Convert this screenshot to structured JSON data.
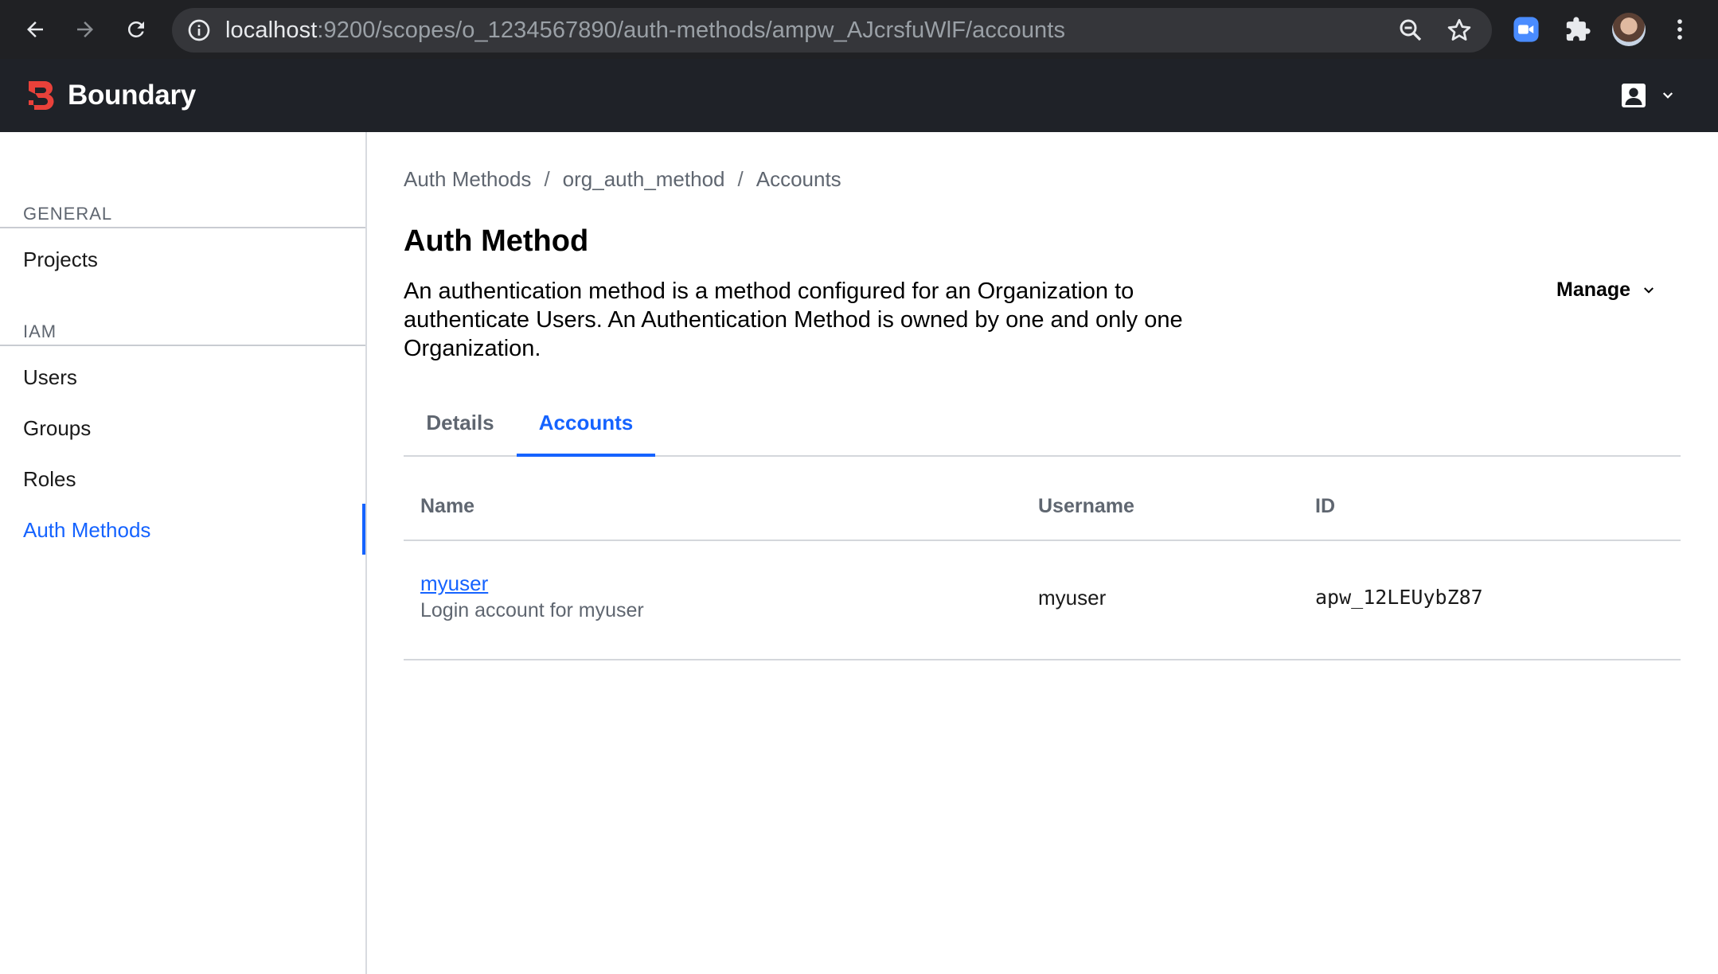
{
  "browser": {
    "url_host": "localhost",
    "url_rest": ":9200/scopes/o_1234567890/auth-methods/ampw_AJcrsfuWlF/accounts",
    "icons": [
      "back-icon",
      "forward-icon",
      "reload-icon",
      "info-icon",
      "zoom-icon",
      "star-icon",
      "zoom-extension-icon",
      "extensions-icon",
      "profile-avatar",
      "kebab-menu-icon"
    ]
  },
  "app": {
    "brand": "Boundary",
    "brand_color": "#e9413a",
    "header_bg": "#1f2228",
    "accent_color": "#1563ff"
  },
  "sidebar": {
    "general_heading": "GENERAL",
    "general_items": [
      {
        "label": "Projects"
      }
    ],
    "iam_heading": "IAM",
    "iam_items": [
      {
        "label": "Users"
      },
      {
        "label": "Groups"
      },
      {
        "label": "Roles"
      },
      {
        "label": "Auth Methods",
        "active": true
      }
    ]
  },
  "breadcrumb": {
    "items": [
      "Auth Methods",
      "org_auth_method",
      "Accounts"
    ],
    "separator": "/"
  },
  "page": {
    "title": "Auth Method",
    "description": "An authentication method is a method configured for an Organization to authenticate Users. An Authentication Method is owned by one and only one Organization.",
    "manage_label": "Manage"
  },
  "tabs": [
    {
      "label": "Details",
      "active": false
    },
    {
      "label": "Accounts",
      "active": true
    }
  ],
  "table": {
    "columns": [
      "Name",
      "Username",
      "ID"
    ],
    "rows": [
      {
        "name": "myuser",
        "description": "Login account for myuser",
        "username": "myuser",
        "id": "apw_12LEUybZ87"
      }
    ]
  }
}
